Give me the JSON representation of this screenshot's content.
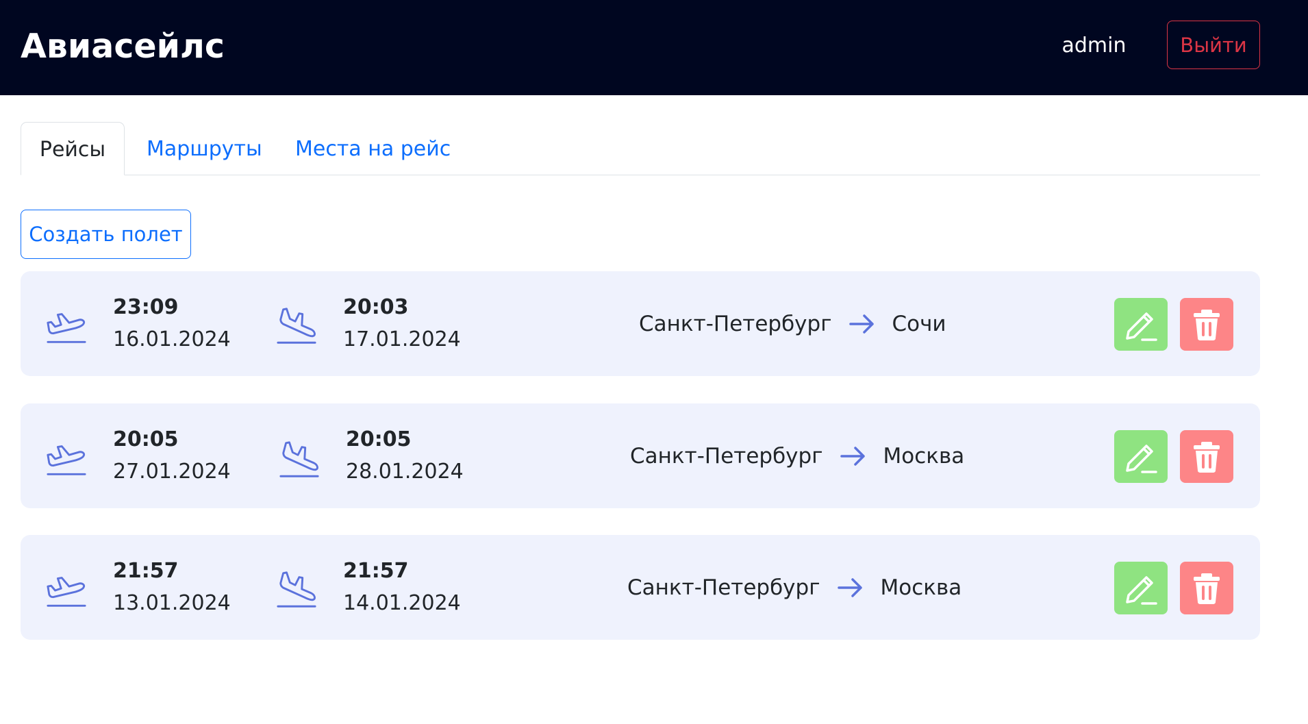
{
  "header": {
    "brand": "Авиасейлс",
    "username": "admin",
    "logout_label": "Выйти"
  },
  "tabs": [
    {
      "label": "Рейсы",
      "active": true
    },
    {
      "label": "Маршруты",
      "active": false
    },
    {
      "label": "Места на рейс",
      "active": false
    }
  ],
  "create_button_label": "Создать полет",
  "flights": [
    {
      "departure": {
        "time": "23:09",
        "date": "16.01.2024"
      },
      "arrival": {
        "time": "20:03",
        "date": "17.01.2024"
      },
      "from": "Санкт-Петербург",
      "to": "Сочи"
    },
    {
      "departure": {
        "time": "20:05",
        "date": "27.01.2024"
      },
      "arrival": {
        "time": "20:05",
        "date": "28.01.2024"
      },
      "from": "Санкт-Петербург",
      "to": "Москва"
    },
    {
      "departure": {
        "time": "21:57",
        "date": "13.01.2024"
      },
      "arrival": {
        "time": "21:57",
        "date": "14.01.2024"
      },
      "from": "Санкт-Петербург",
      "to": "Москва"
    }
  ],
  "icons": {
    "departure": "plane-takeoff-icon",
    "arrival": "plane-landing-icon",
    "route_arrow": "arrow-right-icon",
    "edit": "pencil-icon",
    "delete": "trash-icon"
  },
  "colors": {
    "header_bg": "#000620",
    "card_bg": "#eff2fd",
    "edit_bg": "#8fe381",
    "delete_bg": "#fd8587",
    "accent": "#0d6efd",
    "danger": "#dc3545",
    "icon": "#5b72dc"
  }
}
